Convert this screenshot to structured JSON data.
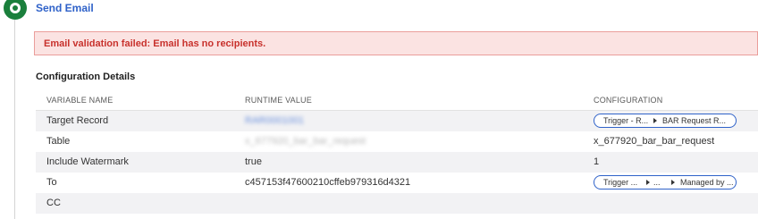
{
  "step": {
    "title": "Send Email",
    "icon": "step-status-icon"
  },
  "error": {
    "message": "Email validation failed: Email has no recipients."
  },
  "config": {
    "section_title": "Configuration Details",
    "columns": [
      "VARIABLE NAME",
      "RUNTIME VALUE",
      "CONFIGURATION"
    ],
    "rows": [
      {
        "name": "Target Record",
        "runtime": "RAR0001001",
        "runtime_obscured": true,
        "config_pill": [
          "Trigger - R...",
          "BAR Request R..."
        ]
      },
      {
        "name": "Table",
        "runtime": "x_677920_bar_bar_request",
        "runtime_obscured": true,
        "config": "x_677920_bar_bar_request"
      },
      {
        "name": "Include Watermark",
        "runtime": "true",
        "config": "1"
      },
      {
        "name": "To",
        "runtime": "c457153f47600210cffeb979316d4321",
        "config_pill": [
          "Trigger ...",
          "...",
          "Managed by ..."
        ]
      },
      {
        "name": "CC",
        "runtime": "",
        "config": ""
      }
    ]
  },
  "colors": {
    "accent": "#2f62c9",
    "error_bg": "#fbe3e2",
    "error_border": "#ea9e9b",
    "error_text": "#c8312c",
    "status_green": "#1a7f3c"
  }
}
